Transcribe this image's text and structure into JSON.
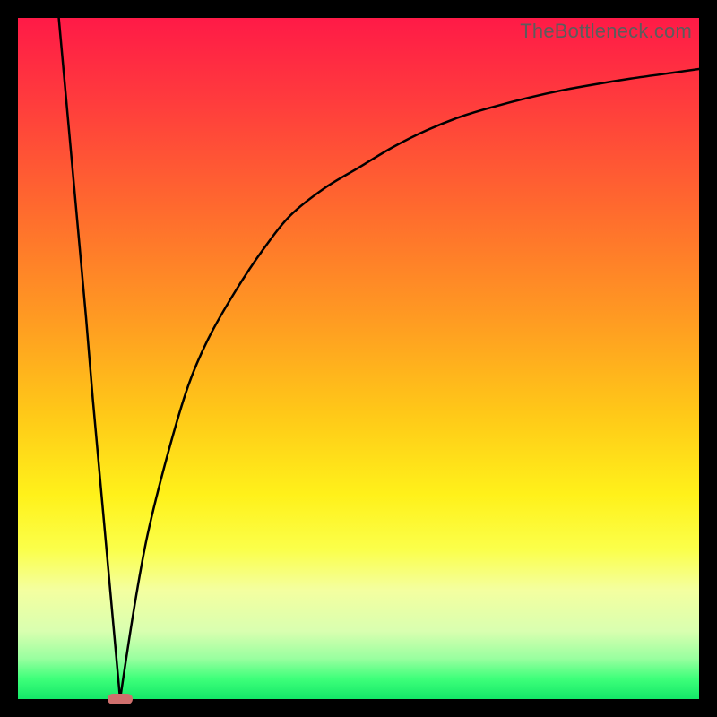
{
  "watermark": "TheBottleneck.com",
  "colors": {
    "curve": "#000000",
    "marker": "#cf6f6d",
    "frame": "#000000"
  },
  "chart_data": {
    "type": "line",
    "title": "",
    "xlabel": "",
    "ylabel": "",
    "xlim": [
      0,
      100
    ],
    "ylim": [
      0,
      100
    ],
    "grid": false,
    "legend": false,
    "annotations": [
      {
        "type": "marker",
        "x": 15,
        "y": 0,
        "shape": "pill",
        "color": "#cf6f6d"
      }
    ],
    "series": [
      {
        "name": "left-branch",
        "x": [
          6,
          7,
          8,
          9,
          10,
          11,
          12,
          13,
          14,
          15
        ],
        "y": [
          100,
          89,
          78,
          67,
          56,
          44,
          33,
          22,
          11,
          0
        ]
      },
      {
        "name": "right-branch",
        "x": [
          15,
          17,
          19,
          22,
          25,
          28,
          32,
          36,
          40,
          45,
          50,
          55,
          60,
          65,
          70,
          75,
          80,
          85,
          90,
          95,
          100
        ],
        "y": [
          0,
          13,
          24,
          36,
          46,
          53,
          60,
          66,
          71,
          75,
          78,
          81,
          83.5,
          85.5,
          87,
          88.3,
          89.4,
          90.3,
          91.1,
          91.8,
          92.5
        ]
      }
    ]
  }
}
